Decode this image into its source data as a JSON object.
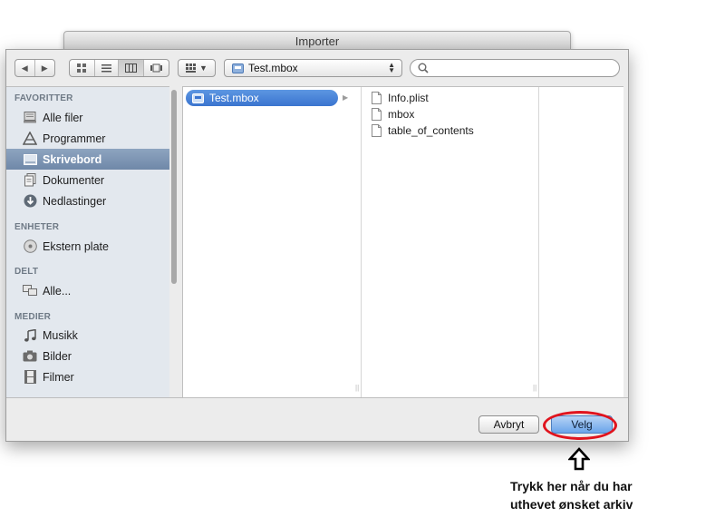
{
  "window": {
    "title": "Importer"
  },
  "toolbar": {
    "path_popup": "Test.mbox",
    "search_placeholder": ""
  },
  "sidebar": {
    "sections": [
      {
        "header": "FAVORITTER",
        "items": [
          {
            "label": "Alle filer",
            "icon": "all-files-icon"
          },
          {
            "label": "Programmer",
            "icon": "applications-icon"
          },
          {
            "label": "Skrivebord",
            "icon": "desktop-icon",
            "selected": true
          },
          {
            "label": "Dokumenter",
            "icon": "documents-icon"
          },
          {
            "label": "Nedlastinger",
            "icon": "downloads-icon"
          }
        ]
      },
      {
        "header": "ENHETER",
        "items": [
          {
            "label": "Ekstern plate",
            "icon": "disk-icon"
          }
        ]
      },
      {
        "header": "DELT",
        "items": [
          {
            "label": "Alle...",
            "icon": "network-icon"
          }
        ]
      },
      {
        "header": "MEDIER",
        "items": [
          {
            "label": "Musikk",
            "icon": "music-icon"
          },
          {
            "label": "Bilder",
            "icon": "camera-icon"
          },
          {
            "label": "Filmer",
            "icon": "film-icon"
          }
        ]
      }
    ]
  },
  "browser": {
    "column1": [
      {
        "label": "Test.mbox",
        "selected": true
      }
    ],
    "column2": [
      {
        "label": "Info.plist"
      },
      {
        "label": "mbox"
      },
      {
        "label": "table_of_contents"
      }
    ]
  },
  "buttons": {
    "cancel": "Avbryt",
    "ok": "Velg"
  },
  "annotation": {
    "line1": "Trykk her når du har",
    "line2": "uthevet ønsket arkiv",
    "color": "#e0141e"
  }
}
